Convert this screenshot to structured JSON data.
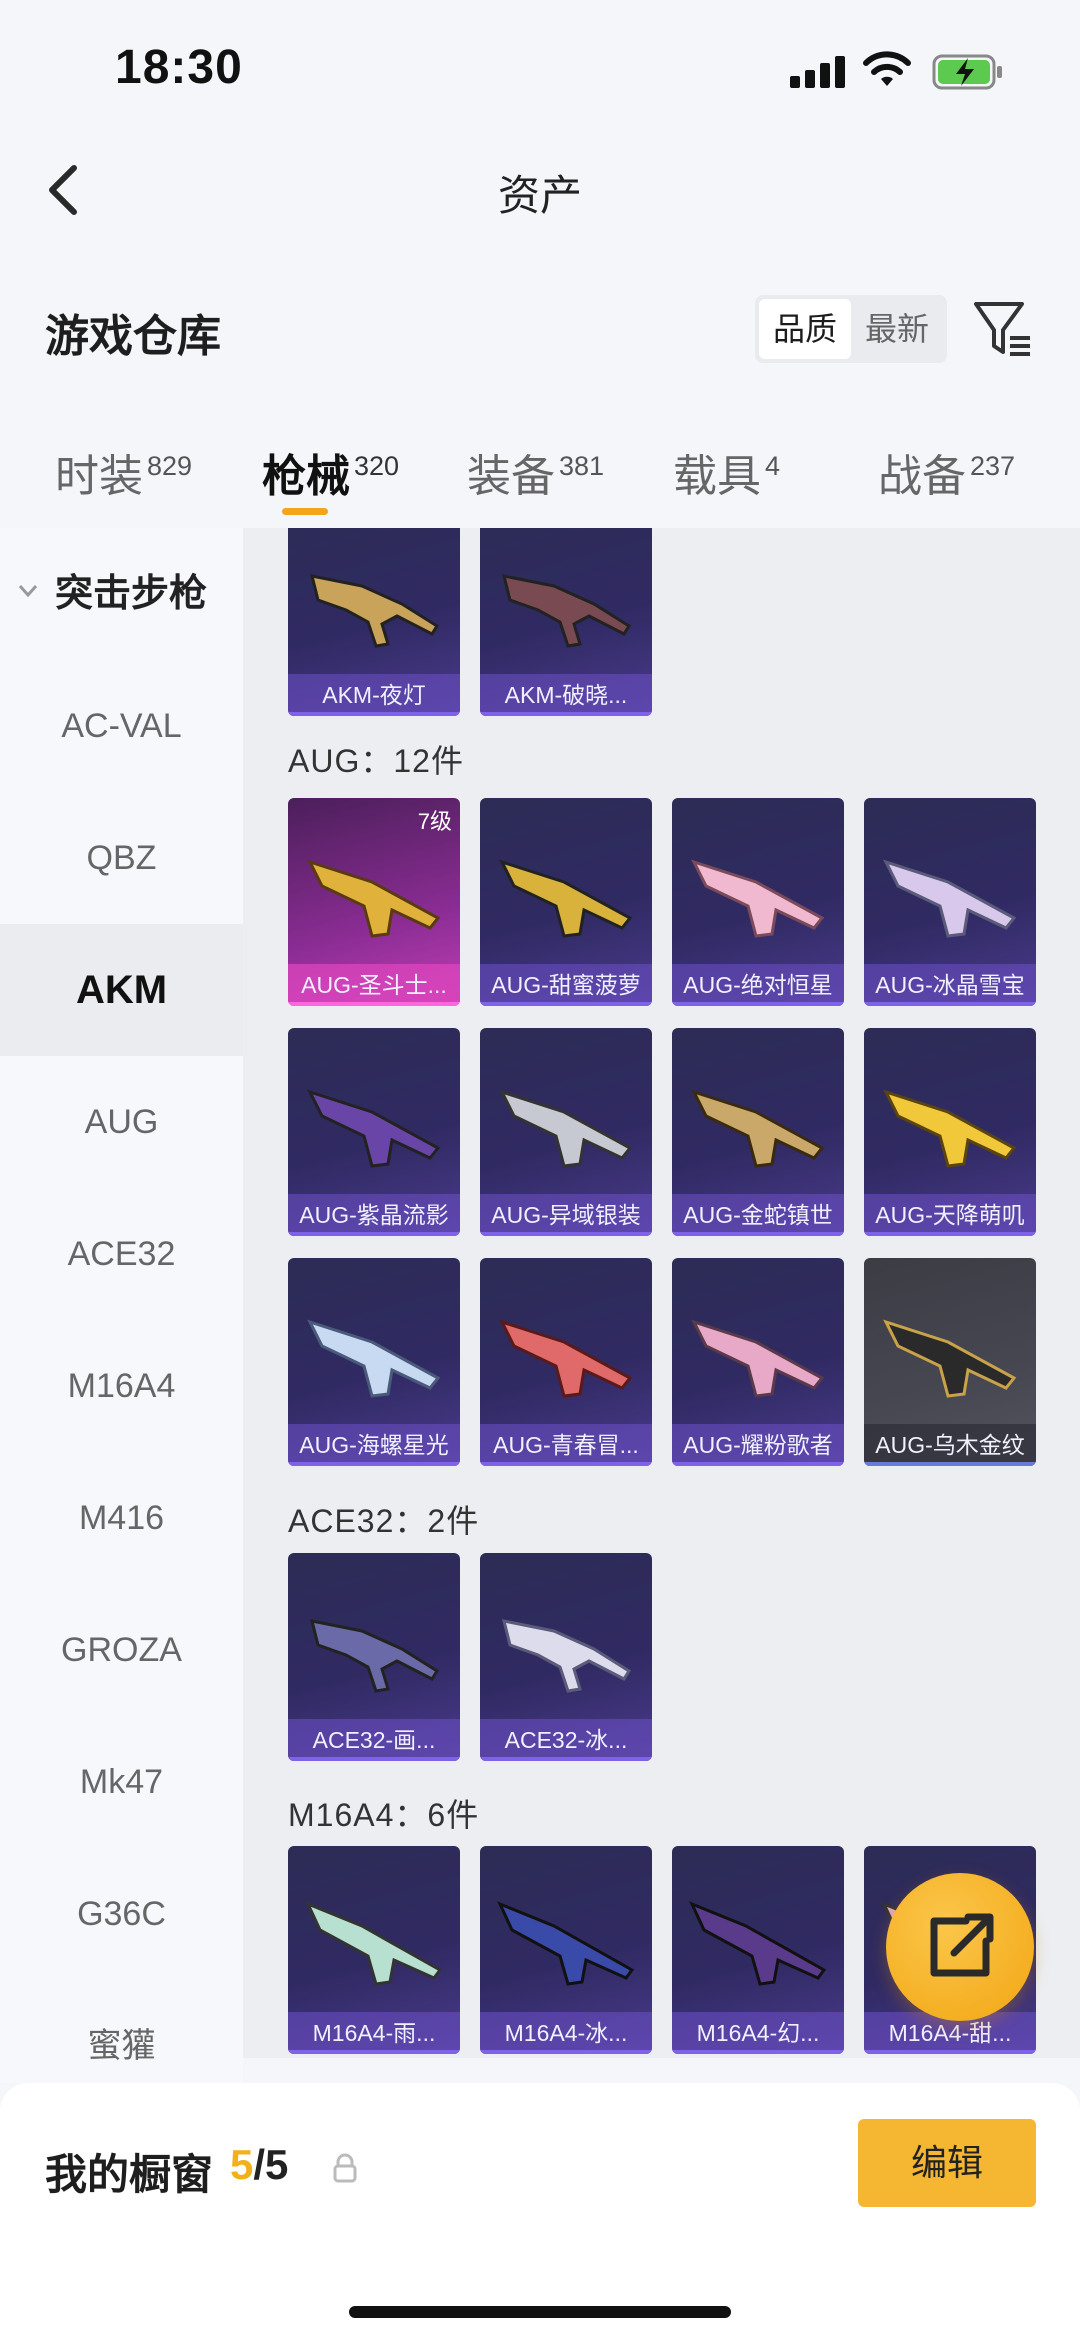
{
  "status_bar": {
    "time": "18:30"
  },
  "header": {
    "title": "资产"
  },
  "warehouse": {
    "title": "游戏仓库",
    "sort_options": [
      "品质",
      "最新"
    ]
  },
  "tabs": [
    {
      "label": "时装",
      "count": "829"
    },
    {
      "label": "枪械",
      "count": "320"
    },
    {
      "label": "装备",
      "count": "381"
    },
    {
      "label": "载具",
      "count": "4"
    },
    {
      "label": "战备",
      "count": "237"
    }
  ],
  "sidebar": {
    "category": "突击步枪",
    "items": [
      "AC-VAL",
      "QBZ",
      "AKM",
      "AUG",
      "ACE32",
      "M16A4",
      "M416",
      "GROZA",
      "Mk47",
      "G36C",
      "蜜獾"
    ],
    "active_item": "AKM"
  },
  "groups": [
    {
      "label": "",
      "items": [
        "AKM-夜灯",
        "AKM-破晓..."
      ]
    },
    {
      "label": "AUG：12件",
      "items": [
        "AUG-圣斗士...",
        "AUG-甜蜜菠萝",
        "AUG-绝对恒星",
        "AUG-冰晶雪宝",
        "AUG-紫晶流影",
        "AUG-异域银装",
        "AUG-金蛇镇世",
        "AUG-天降萌叽",
        "AUG-海螺星光",
        "AUG-青春冒...",
        "AUG-耀粉歌者",
        "AUG-乌木金纹"
      ]
    },
    {
      "label": "ACE32：2件",
      "items": [
        "ACE32-画...",
        "ACE32-冰..."
      ]
    },
    {
      "label": "M16A4：6件",
      "items": [
        "M16A4-雨...",
        "M16A4-冰...",
        "M16A4-幻...",
        "M16A4-甜..."
      ]
    }
  ],
  "badge_level": "7级",
  "showcase": {
    "label": "我的橱窗",
    "current": "5",
    "total": "/5"
  },
  "edit_button": "编辑",
  "colors": {
    "accent": "#f3a51a",
    "card_purple": "#302a63",
    "legend_pink": "#c13fb5"
  }
}
